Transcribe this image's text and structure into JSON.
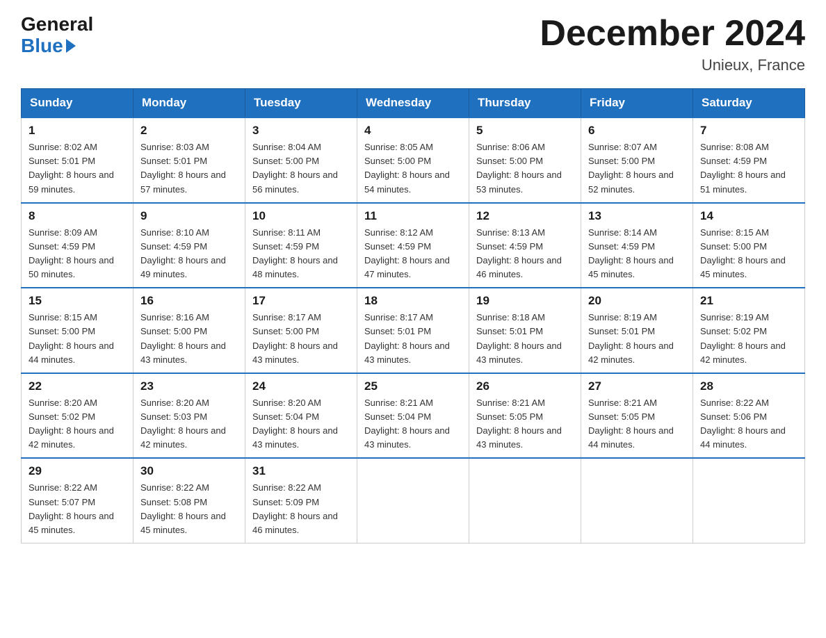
{
  "logo": {
    "general": "General",
    "blue": "Blue",
    "arrow": "▶"
  },
  "title": "December 2024",
  "location": "Unieux, France",
  "weekdays": [
    "Sunday",
    "Monday",
    "Tuesday",
    "Wednesday",
    "Thursday",
    "Friday",
    "Saturday"
  ],
  "weeks": [
    [
      {
        "day": "1",
        "sunrise": "8:02 AM",
        "sunset": "5:01 PM",
        "daylight": "8 hours and 59 minutes."
      },
      {
        "day": "2",
        "sunrise": "8:03 AM",
        "sunset": "5:01 PM",
        "daylight": "8 hours and 57 minutes."
      },
      {
        "day": "3",
        "sunrise": "8:04 AM",
        "sunset": "5:00 PM",
        "daylight": "8 hours and 56 minutes."
      },
      {
        "day": "4",
        "sunrise": "8:05 AM",
        "sunset": "5:00 PM",
        "daylight": "8 hours and 54 minutes."
      },
      {
        "day": "5",
        "sunrise": "8:06 AM",
        "sunset": "5:00 PM",
        "daylight": "8 hours and 53 minutes."
      },
      {
        "day": "6",
        "sunrise": "8:07 AM",
        "sunset": "5:00 PM",
        "daylight": "8 hours and 52 minutes."
      },
      {
        "day": "7",
        "sunrise": "8:08 AM",
        "sunset": "4:59 PM",
        "daylight": "8 hours and 51 minutes."
      }
    ],
    [
      {
        "day": "8",
        "sunrise": "8:09 AM",
        "sunset": "4:59 PM",
        "daylight": "8 hours and 50 minutes."
      },
      {
        "day": "9",
        "sunrise": "8:10 AM",
        "sunset": "4:59 PM",
        "daylight": "8 hours and 49 minutes."
      },
      {
        "day": "10",
        "sunrise": "8:11 AM",
        "sunset": "4:59 PM",
        "daylight": "8 hours and 48 minutes."
      },
      {
        "day": "11",
        "sunrise": "8:12 AM",
        "sunset": "4:59 PM",
        "daylight": "8 hours and 47 minutes."
      },
      {
        "day": "12",
        "sunrise": "8:13 AM",
        "sunset": "4:59 PM",
        "daylight": "8 hours and 46 minutes."
      },
      {
        "day": "13",
        "sunrise": "8:14 AM",
        "sunset": "4:59 PM",
        "daylight": "8 hours and 45 minutes."
      },
      {
        "day": "14",
        "sunrise": "8:15 AM",
        "sunset": "5:00 PM",
        "daylight": "8 hours and 45 minutes."
      }
    ],
    [
      {
        "day": "15",
        "sunrise": "8:15 AM",
        "sunset": "5:00 PM",
        "daylight": "8 hours and 44 minutes."
      },
      {
        "day": "16",
        "sunrise": "8:16 AM",
        "sunset": "5:00 PM",
        "daylight": "8 hours and 43 minutes."
      },
      {
        "day": "17",
        "sunrise": "8:17 AM",
        "sunset": "5:00 PM",
        "daylight": "8 hours and 43 minutes."
      },
      {
        "day": "18",
        "sunrise": "8:17 AM",
        "sunset": "5:01 PM",
        "daylight": "8 hours and 43 minutes."
      },
      {
        "day": "19",
        "sunrise": "8:18 AM",
        "sunset": "5:01 PM",
        "daylight": "8 hours and 43 minutes."
      },
      {
        "day": "20",
        "sunrise": "8:19 AM",
        "sunset": "5:01 PM",
        "daylight": "8 hours and 42 minutes."
      },
      {
        "day": "21",
        "sunrise": "8:19 AM",
        "sunset": "5:02 PM",
        "daylight": "8 hours and 42 minutes."
      }
    ],
    [
      {
        "day": "22",
        "sunrise": "8:20 AM",
        "sunset": "5:02 PM",
        "daylight": "8 hours and 42 minutes."
      },
      {
        "day": "23",
        "sunrise": "8:20 AM",
        "sunset": "5:03 PM",
        "daylight": "8 hours and 42 minutes."
      },
      {
        "day": "24",
        "sunrise": "8:20 AM",
        "sunset": "5:04 PM",
        "daylight": "8 hours and 43 minutes."
      },
      {
        "day": "25",
        "sunrise": "8:21 AM",
        "sunset": "5:04 PM",
        "daylight": "8 hours and 43 minutes."
      },
      {
        "day": "26",
        "sunrise": "8:21 AM",
        "sunset": "5:05 PM",
        "daylight": "8 hours and 43 minutes."
      },
      {
        "day": "27",
        "sunrise": "8:21 AM",
        "sunset": "5:05 PM",
        "daylight": "8 hours and 44 minutes."
      },
      {
        "day": "28",
        "sunrise": "8:22 AM",
        "sunset": "5:06 PM",
        "daylight": "8 hours and 44 minutes."
      }
    ],
    [
      {
        "day": "29",
        "sunrise": "8:22 AM",
        "sunset": "5:07 PM",
        "daylight": "8 hours and 45 minutes."
      },
      {
        "day": "30",
        "sunrise": "8:22 AM",
        "sunset": "5:08 PM",
        "daylight": "8 hours and 45 minutes."
      },
      {
        "day": "31",
        "sunrise": "8:22 AM",
        "sunset": "5:09 PM",
        "daylight": "8 hours and 46 minutes."
      },
      null,
      null,
      null,
      null
    ]
  ],
  "labels": {
    "sunrise": "Sunrise:",
    "sunset": "Sunset:",
    "daylight": "Daylight:"
  }
}
